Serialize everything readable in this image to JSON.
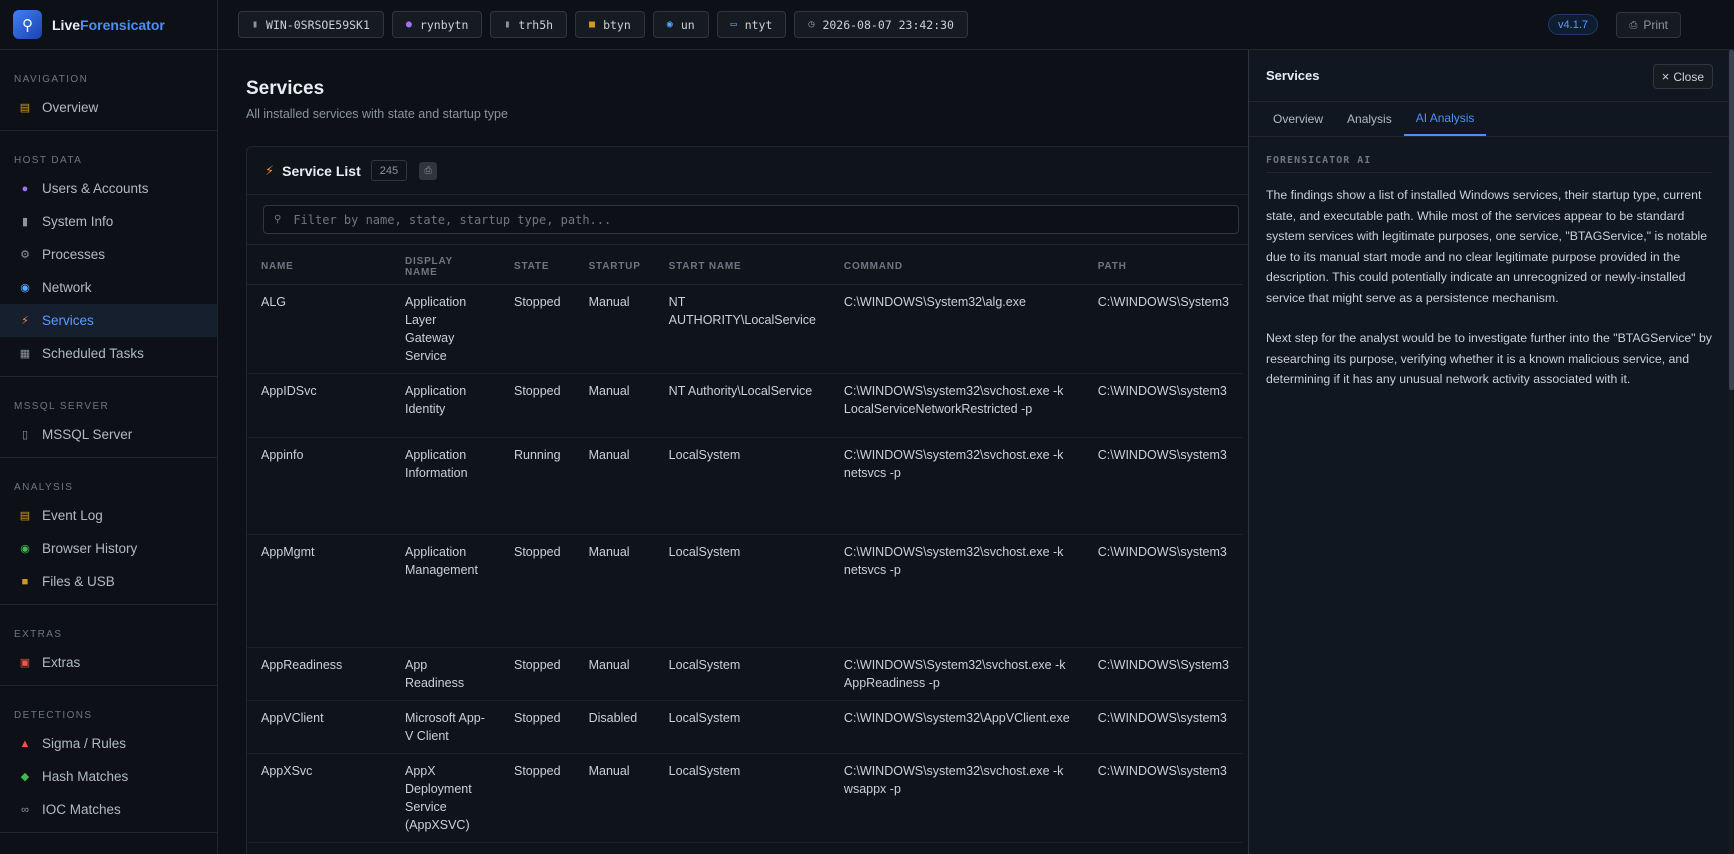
{
  "brand": {
    "name_part1": "Live",
    "name_part2": "Forensicator",
    "logo_icon": "magnifier-icon"
  },
  "sidebar": {
    "sections": [
      {
        "title": "NAVIGATION",
        "items": [
          {
            "label": "Overview",
            "icon": "chart-icon",
            "active": false
          }
        ]
      },
      {
        "title": "HOST DATA",
        "items": [
          {
            "label": "Users & Accounts",
            "icon": "user-icon",
            "active": false
          },
          {
            "label": "System Info",
            "icon": "device-icon",
            "active": false
          },
          {
            "label": "Processes",
            "icon": "gear-icon",
            "active": false
          },
          {
            "label": "Network",
            "icon": "globe-icon",
            "active": false
          },
          {
            "label": "Services",
            "icon": "bolt-icon",
            "active": true
          },
          {
            "label": "Scheduled Tasks",
            "icon": "calendar-icon",
            "active": false
          }
        ]
      },
      {
        "title": "MSSQL SERVER",
        "items": [
          {
            "label": "MSSQL Server",
            "icon": "database-icon",
            "active": false
          }
        ]
      },
      {
        "title": "ANALYSIS",
        "items": [
          {
            "label": "Event Log",
            "icon": "log-icon",
            "active": false
          },
          {
            "label": "Browser History",
            "icon": "browser-icon",
            "active": false
          },
          {
            "label": "Files & USB",
            "icon": "folder-icon",
            "active": false
          }
        ]
      },
      {
        "title": "EXTRAS",
        "items": [
          {
            "label": "Extras",
            "icon": "toolbox-icon",
            "active": false
          }
        ]
      },
      {
        "title": "DETECTIONS",
        "items": [
          {
            "label": "Sigma / Rules",
            "icon": "siren-icon",
            "active": false
          },
          {
            "label": "Hash Matches",
            "icon": "hash-icon",
            "active": false
          },
          {
            "label": "IOC Matches",
            "icon": "link-icon",
            "active": false
          }
        ]
      }
    ]
  },
  "topbar": {
    "chips": [
      {
        "icon": "device-icon",
        "text": "WIN-0SRSOE59SK1"
      },
      {
        "icon": "user-icon",
        "text": "rynbytn"
      },
      {
        "icon": "device-icon",
        "text": "trh5h"
      },
      {
        "icon": "folder-icon",
        "text": "btyn"
      },
      {
        "icon": "globe-icon",
        "text": "un"
      },
      {
        "icon": "monitor-icon",
        "text": "ntyt"
      },
      {
        "icon": "clock-icon",
        "text": "2026-08-07 23:42:30"
      }
    ],
    "version": "v4.1.7",
    "print_label": "Print"
  },
  "page": {
    "title": "Services",
    "subtitle": "All installed services with state and startup type"
  },
  "card": {
    "title": "Service List",
    "count": "245",
    "filter_placeholder": "Filter by name, state, startup type, path...",
    "columns": [
      "NAME",
      "DISPLAY NAME",
      "STATE",
      "STARTUP",
      "START NAME",
      "COMMAND",
      "PATH"
    ],
    "rows": [
      {
        "name": "ALG",
        "display": "Application Layer Gateway Service",
        "state": "Stopped",
        "startup": "Manual",
        "start_name": "NT AUTHORITY\\LocalService",
        "command": "C:\\WINDOWS\\System32\\alg.exe",
        "path": "C:\\WINDOWS\\System3"
      },
      {
        "name": "AppIDSvc",
        "display": "Application Identity",
        "state": "Stopped",
        "startup": "Manual",
        "start_name": "NT Authority\\LocalService",
        "command": "C:\\WINDOWS\\system32\\svchost.exe -k LocalServiceNetworkRestricted -p",
        "path": "C:\\WINDOWS\\system3"
      },
      {
        "name": "Appinfo",
        "display": "Application Information",
        "state": "Running",
        "startup": "Manual",
        "start_name": "LocalSystem",
        "command": "C:\\WINDOWS\\system32\\svchost.exe -k netsvcs -p",
        "path": "C:\\WINDOWS\\system3"
      },
      {
        "name": "AppMgmt",
        "display": "Application Management",
        "state": "Stopped",
        "startup": "Manual",
        "start_name": "LocalSystem",
        "command": "C:\\WINDOWS\\system32\\svchost.exe -k netsvcs -p",
        "path": "C:\\WINDOWS\\system3"
      },
      {
        "name": "AppReadiness",
        "display": "App Readiness",
        "state": "Stopped",
        "startup": "Manual",
        "start_name": "LocalSystem",
        "command": "C:\\WINDOWS\\System32\\svchost.exe -k AppReadiness -p",
        "path": "C:\\WINDOWS\\System3"
      },
      {
        "name": "AppVClient",
        "display": "Microsoft App-V Client",
        "state": "Stopped",
        "startup": "Disabled",
        "start_name": "LocalSystem",
        "command": "C:\\WINDOWS\\system32\\AppVClient.exe",
        "path": "C:\\WINDOWS\\system3"
      },
      {
        "name": "AppXSvc",
        "display": "AppX Deployment Service (AppXSVC)",
        "state": "Stopped",
        "startup": "Manual",
        "start_name": "LocalSystem",
        "command": "C:\\WINDOWS\\system32\\svchost.exe -k wsappx -p",
        "path": "C:\\WINDOWS\\system3"
      }
    ]
  },
  "panel": {
    "title": "Services",
    "close_label": "Close",
    "tabs": [
      {
        "label": "Overview",
        "active": false
      },
      {
        "label": "Analysis",
        "active": false
      },
      {
        "label": "AI Analysis",
        "active": true
      }
    ],
    "ai_label": "FORENSICATOR AI",
    "paragraphs": [
      "The findings show a list of installed Windows services, their startup type, current state, and executable path. While most of the services appear to be standard system services with legitimate purposes, one service, \"BTAGService,\" is notable due to its manual start mode and no clear legitimate purpose provided in the description. This could potentially indicate an unrecognized or newly-installed service that might serve as a persistence mechanism.",
      "Next step for the analyst would be to investigate further into the \"BTAGService\" by researching its purpose, verifying whether it is a known malicious service, and determining if it has any unusual network activity associated with it."
    ]
  }
}
